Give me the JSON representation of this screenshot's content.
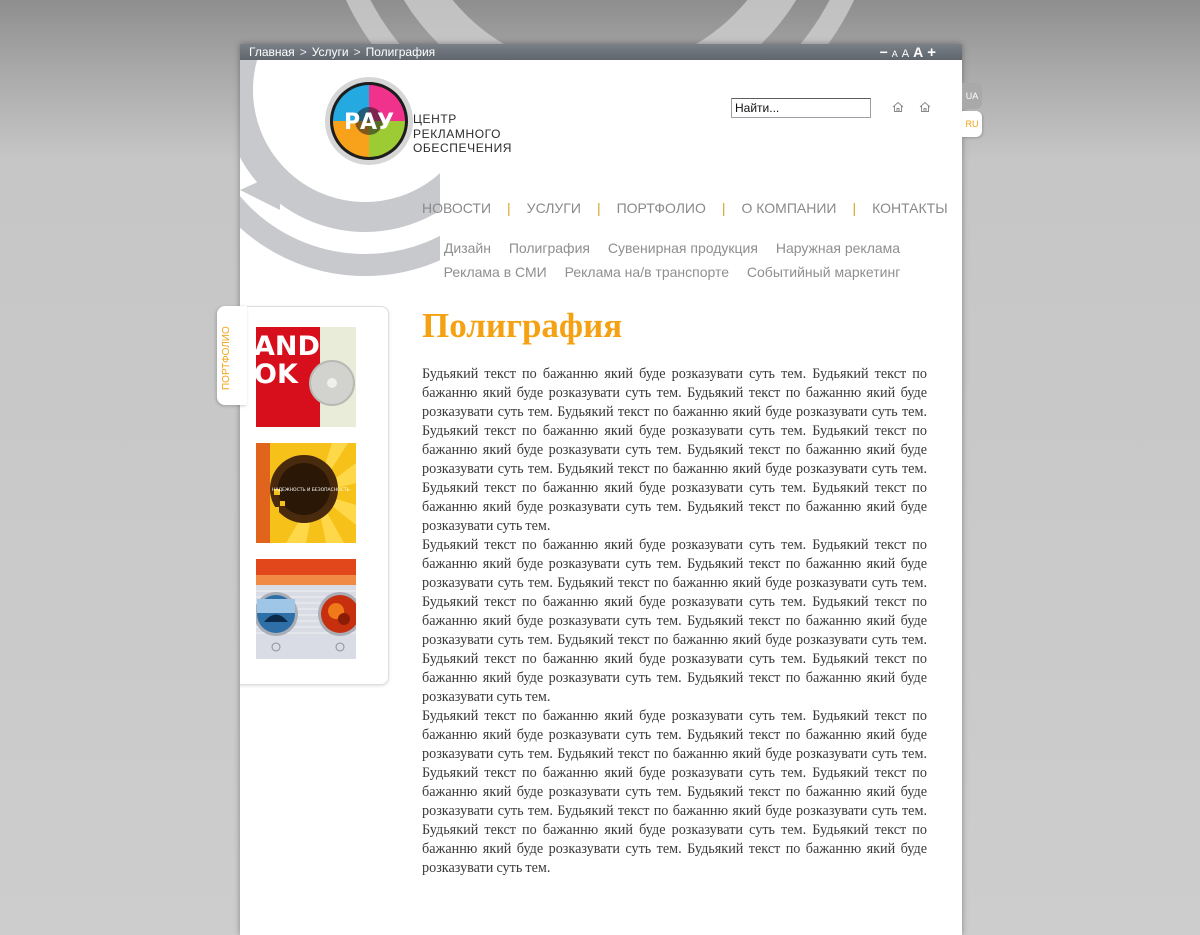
{
  "breadcrumb": {
    "items": [
      "Главная",
      "Услуги",
      "Полиграфия"
    ],
    "separator": ">"
  },
  "font_controls": [
    "−",
    "A",
    "A",
    "A",
    "+"
  ],
  "logo": {
    "mark": "РАУ",
    "line1": "ЦЕНТР",
    "line2": "РЕКЛАМНОГО",
    "line3": "ОБЕСПЕЧЕНИЯ"
  },
  "search": {
    "placeholder": "Найти..."
  },
  "icons": {
    "home1": "home-icon",
    "home2": "home-icon"
  },
  "languages": {
    "ua": "UA",
    "ru": "RU",
    "active": "RU"
  },
  "main_nav": [
    "НОВОСТИ",
    "УСЛУГИ",
    "ПОРТФОЛИО",
    "О КОМПАНИИ",
    "КОНТАКТЫ"
  ],
  "sub_nav": {
    "row1": [
      "Дизайн",
      "Полиграфия",
      "Сувенирная продукция",
      "Наружная реклама"
    ],
    "row2": [
      "Реклама в СМИ",
      "Реклама на/в транспорте",
      "Событийный маркетинг"
    ]
  },
  "portfolio": {
    "tab_label": "ПОРТФОЛИО",
    "thumb1_text": [
      "AND",
      "OK"
    ],
    "thumb2_text": "НАДЕЖНОСТЬ И БЕЗОПАСНОСТЬ"
  },
  "page_title": "Полиграфия",
  "content": {
    "paragraphs": [
      "Будьякий текст по бажанню який буде розказувати суть тем. Будьякий текст по бажанню який буде розказувати суть тем. Будьякий текст по бажанню який буде розказувати суть тем. Будьякий текст по бажанню який буде розказувати суть тем. Будьякий текст по бажанню який буде розказувати суть тем. Будьякий текст по бажанню який буде розказувати суть тем. Будьякий текст по бажанню який буде розказувати суть тем. Будьякий текст по бажанню який буде розказувати суть тем. Будьякий текст по бажанню який буде розказувати суть тем. Будьякий текст по бажанню який буде розказувати суть тем. Будьякий текст по бажанню який буде розказувати суть тем.",
      "Будьякий текст по бажанню який буде розказувати суть тем. Будьякий текст по бажанню який буде розказувати суть тем. Будьякий текст по бажанню який буде розказувати суть тем. Будьякий текст по бажанню який буде розказувати суть тем. Будьякий текст по бажанню який буде розказувати суть тем. Будьякий текст по бажанню який буде розказувати суть тем. Будьякий текст по бажанню який буде розказувати суть тем. Будьякий текст по бажанню який буде розказувати суть тем. Будьякий текст по бажанню який буде розказувати суть тем. Будьякий текст по бажанню який буде розказувати суть тем. Будьякий текст по бажанню який буде розказувати суть тем.",
      "Будьякий текст по бажанню який буде розказувати суть тем. Будьякий текст по бажанню який буде розказувати суть тем. Будьякий текст по бажанню який буде розказувати суть тем. Будьякий текст по бажанню який буде розказувати суть тем. Будьякий текст по бажанню який буде розказувати суть тем. Будьякий текст по бажанню який буде розказувати суть тем. Будьякий текст по бажанню який буде розказувати суть тем. Будьякий текст по бажанню який буде розказувати суть тем. Будьякий текст по бажанню який буде розказувати суть тем. Будьякий текст по бажанню який буде розказувати суть тем. Будьякий текст по бажанню який буде розказувати суть тем."
    ]
  },
  "colors": {
    "accent": "#f4a213",
    "nav_separator": "#d4a52a",
    "topbar": "#6b7077",
    "text": "#3a3a3a"
  }
}
